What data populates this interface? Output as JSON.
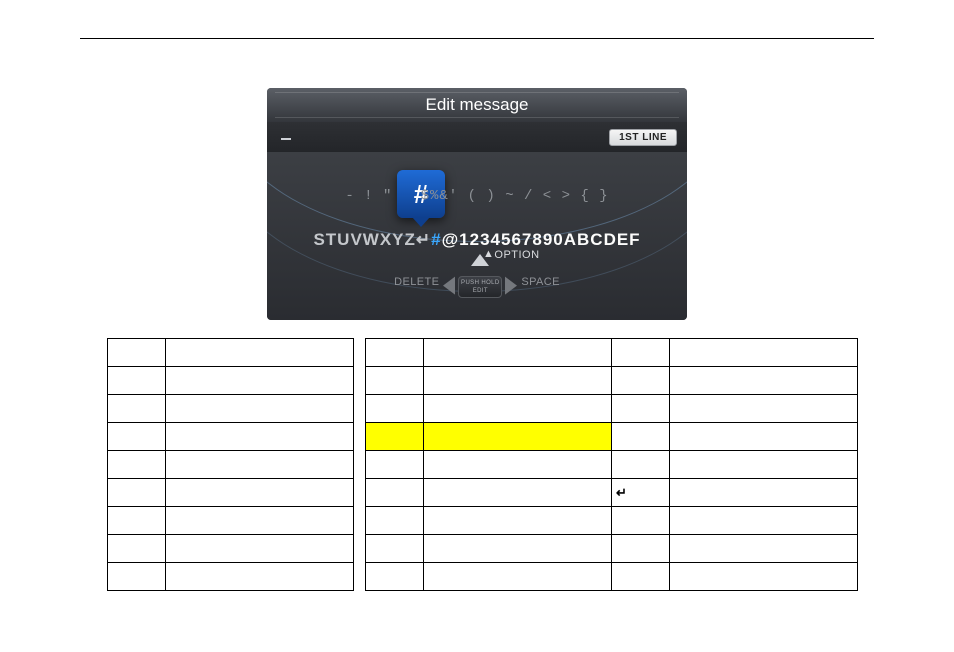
{
  "device": {
    "title": "Edit message",
    "line_badge": "1ST LINE",
    "symbol_row": "- ! \"   $%&' ( ) ~ / < > { }",
    "char_row_left": "STUVWXYZ",
    "char_row_enter": "↵",
    "char_row_highlight": "#",
    "char_row_after": "@1234567890ABCDEF",
    "popup_char": "#",
    "option_label": "OPTION",
    "delete_label": "DELETE",
    "space_label": "SPACE",
    "center_top": "PUSH HOLD",
    "center_bot": "EDIT"
  },
  "rows": [
    {
      "a_code": "",
      "a_desc": "",
      "b_code": "",
      "b_desc": "",
      "c_code": "",
      "c_desc": ""
    },
    {
      "a_code": "",
      "a_desc": "",
      "b_code": "",
      "b_desc": "",
      "c_code": "",
      "c_desc": ""
    },
    {
      "a_code": "",
      "a_desc": "",
      "b_code": "",
      "b_desc": "",
      "c_code": "",
      "c_desc": ""
    },
    {
      "a_code": "",
      "a_desc": "",
      "b_code": "",
      "b_desc": "",
      "b_hl": true,
      "c_code": "",
      "c_desc": ""
    },
    {
      "a_code": "",
      "a_desc": "",
      "b_code": "",
      "b_desc": "",
      "c_code": "",
      "c_desc": ""
    },
    {
      "a_code": "",
      "a_desc": "",
      "b_code": "",
      "b_desc": "",
      "c_code": "↵",
      "c_desc": ""
    },
    {
      "a_code": "",
      "a_desc": "",
      "b_code": "",
      "b_desc": "",
      "c_code": "",
      "c_desc": ""
    },
    {
      "a_code": "",
      "a_desc": "",
      "b_code": "",
      "b_desc": "",
      "c_code": "",
      "c_desc": ""
    },
    {
      "a_code": "",
      "a_desc": "",
      "b_code": "",
      "b_desc": "",
      "c_code": "",
      "c_desc": ""
    }
  ]
}
